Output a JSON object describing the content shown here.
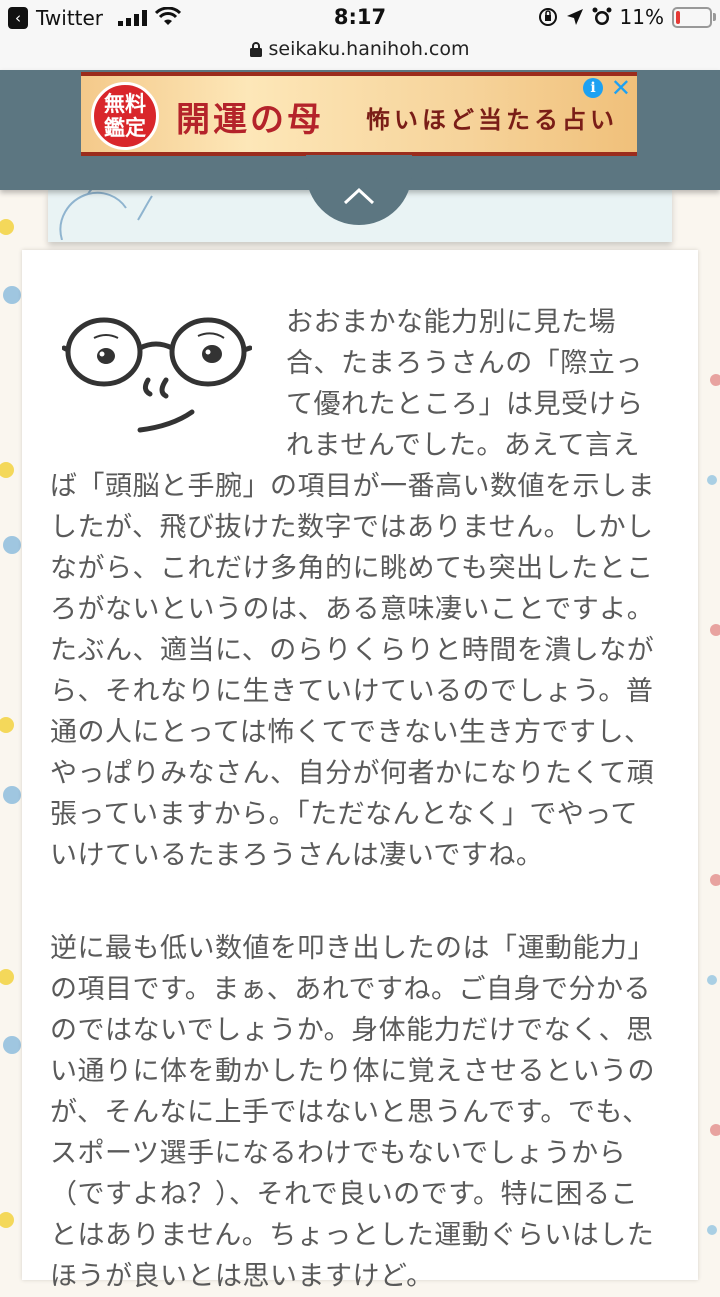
{
  "status_bar": {
    "back_app": "Twitter",
    "time": "8:17",
    "battery_percent": "11%",
    "battery_level": 0.11
  },
  "url_bar": {
    "domain": "seikaku.hanihoh.com"
  },
  "ad": {
    "badge_line1": "無料",
    "badge_line2": "鑑定",
    "title": "開運の母",
    "subtitle": "怖いほど当たる占い",
    "info_glyph": "i",
    "close_glyph": "✕"
  },
  "article": {
    "paragraph1": "おおまかな能力別に見た場合、たまろうさんの「際立って優れたところ」は見受けられませんでした。あえて言えば「頭脳と手腕」の項目が一番高い数値を示しましたが、飛び抜けた数字ではありません。しかしながら、これだけ多角的に眺めても突出したところがないというのは、ある意味凄いことですよ。たぶん、適当に、のらりくらりと時間を潰しながら、それなりに生きていけているのでしょう。普通の人にとっては怖くてできない生き方ですし、やっぱりみなさん、自分が何者かになりたくて頑張っていますから。「ただなんとなく」でやっていけているたまろうさんは凄いですね。",
    "paragraph2": "逆に最も低い数値を叩き出したのは「運動能力」の項目です。まぁ、あれですね。ご自身で分かるのではないでしょうか。身体能力だけでなく、思い通りに体を動かしたり体に覚えさせるというのが、そんなに上手ではないと思うんです。でも、スポーツ選手になるわけでもないでしょうから（ですよね？）、それで良いのです。特に困ることはありません。ちょっとした運動ぐらいはしたほうが良いとは思いますけど。"
  },
  "colors": {
    "header_band": "#5c7681",
    "text": "#5a5a5a",
    "ad_red": "#b4232a",
    "battery_low": "#e53935"
  }
}
